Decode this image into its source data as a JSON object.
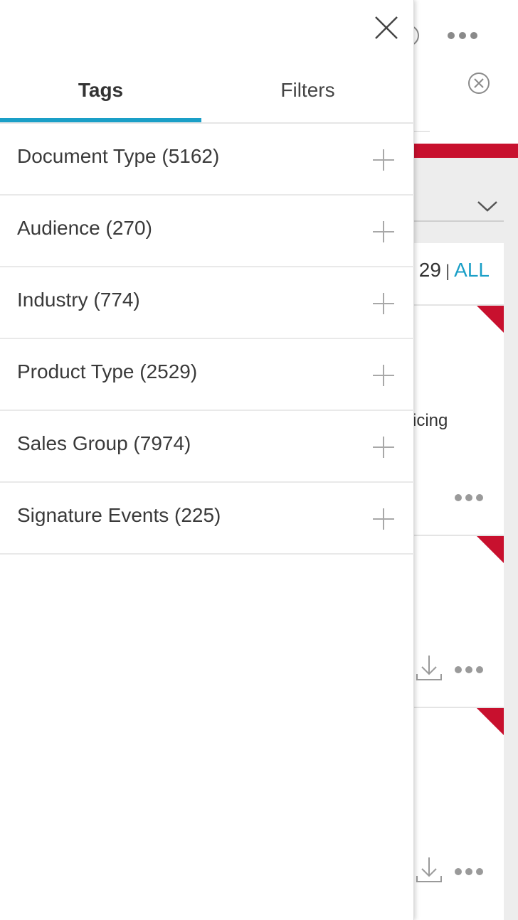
{
  "background": {
    "result_count": "29",
    "separator": "|",
    "all_link": "ALL",
    "card_snippet": "icing",
    "icons": {
      "help": "help-circle-icon",
      "more": "more-dots-icon",
      "clear": "clear-circle-icon",
      "sort": "chevron-down-icon",
      "download": "download-icon",
      "flag": "red-corner-flag-icon"
    },
    "colors": {
      "accent_red": "#c8102e",
      "link_blue": "#1a9fc7"
    }
  },
  "drawer": {
    "close_icon": "close-icon",
    "tabs": [
      {
        "label": "Tags",
        "active": true
      },
      {
        "label": "Filters",
        "active": false
      }
    ],
    "tags": [
      {
        "label": "Document Type (5162)",
        "icon": "plus-icon"
      },
      {
        "label": "Audience (270)",
        "icon": "plus-icon"
      },
      {
        "label": "Industry (774)",
        "icon": "plus-icon"
      },
      {
        "label": "Product Type (2529)",
        "icon": "plus-icon"
      },
      {
        "label": "Sales Group (7974)",
        "icon": "plus-icon"
      },
      {
        "label": "Signature Events (225)",
        "icon": "plus-icon"
      }
    ],
    "colors": {
      "tab_indicator": "#1a9fc7"
    }
  }
}
